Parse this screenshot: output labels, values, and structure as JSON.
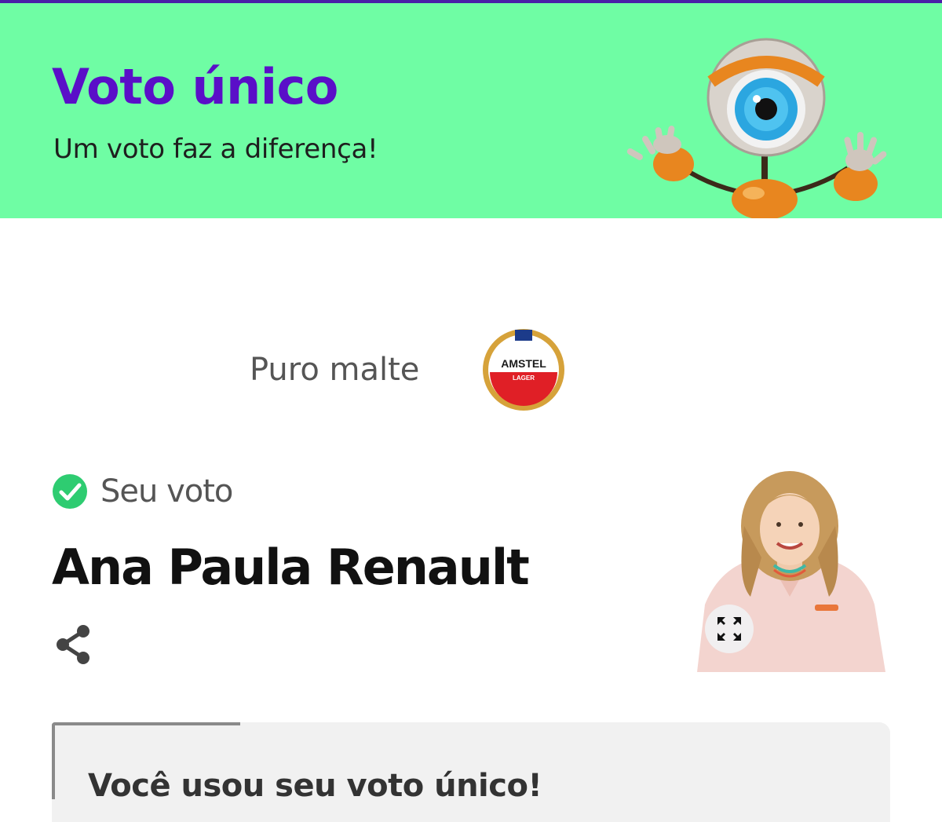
{
  "header": {
    "title": "Voto único",
    "subtitle": "Um voto faz a diferença!",
    "background_color": "#6ffda4",
    "title_color": "#5a0fc8"
  },
  "sponsor": {
    "text": "Puro malte",
    "logo_text_top": "AMSTEL",
    "logo_text_bottom": "LAGER"
  },
  "vote": {
    "status_label": "Seu voto",
    "status_icon": "check-circle-icon",
    "status_color": "#2ecc71",
    "candidate_name": "Ana Paula Renault"
  },
  "icons": {
    "share": "share-icon",
    "expand": "expand-icon"
  },
  "result_card": {
    "title": "Você usou seu voto único!"
  }
}
